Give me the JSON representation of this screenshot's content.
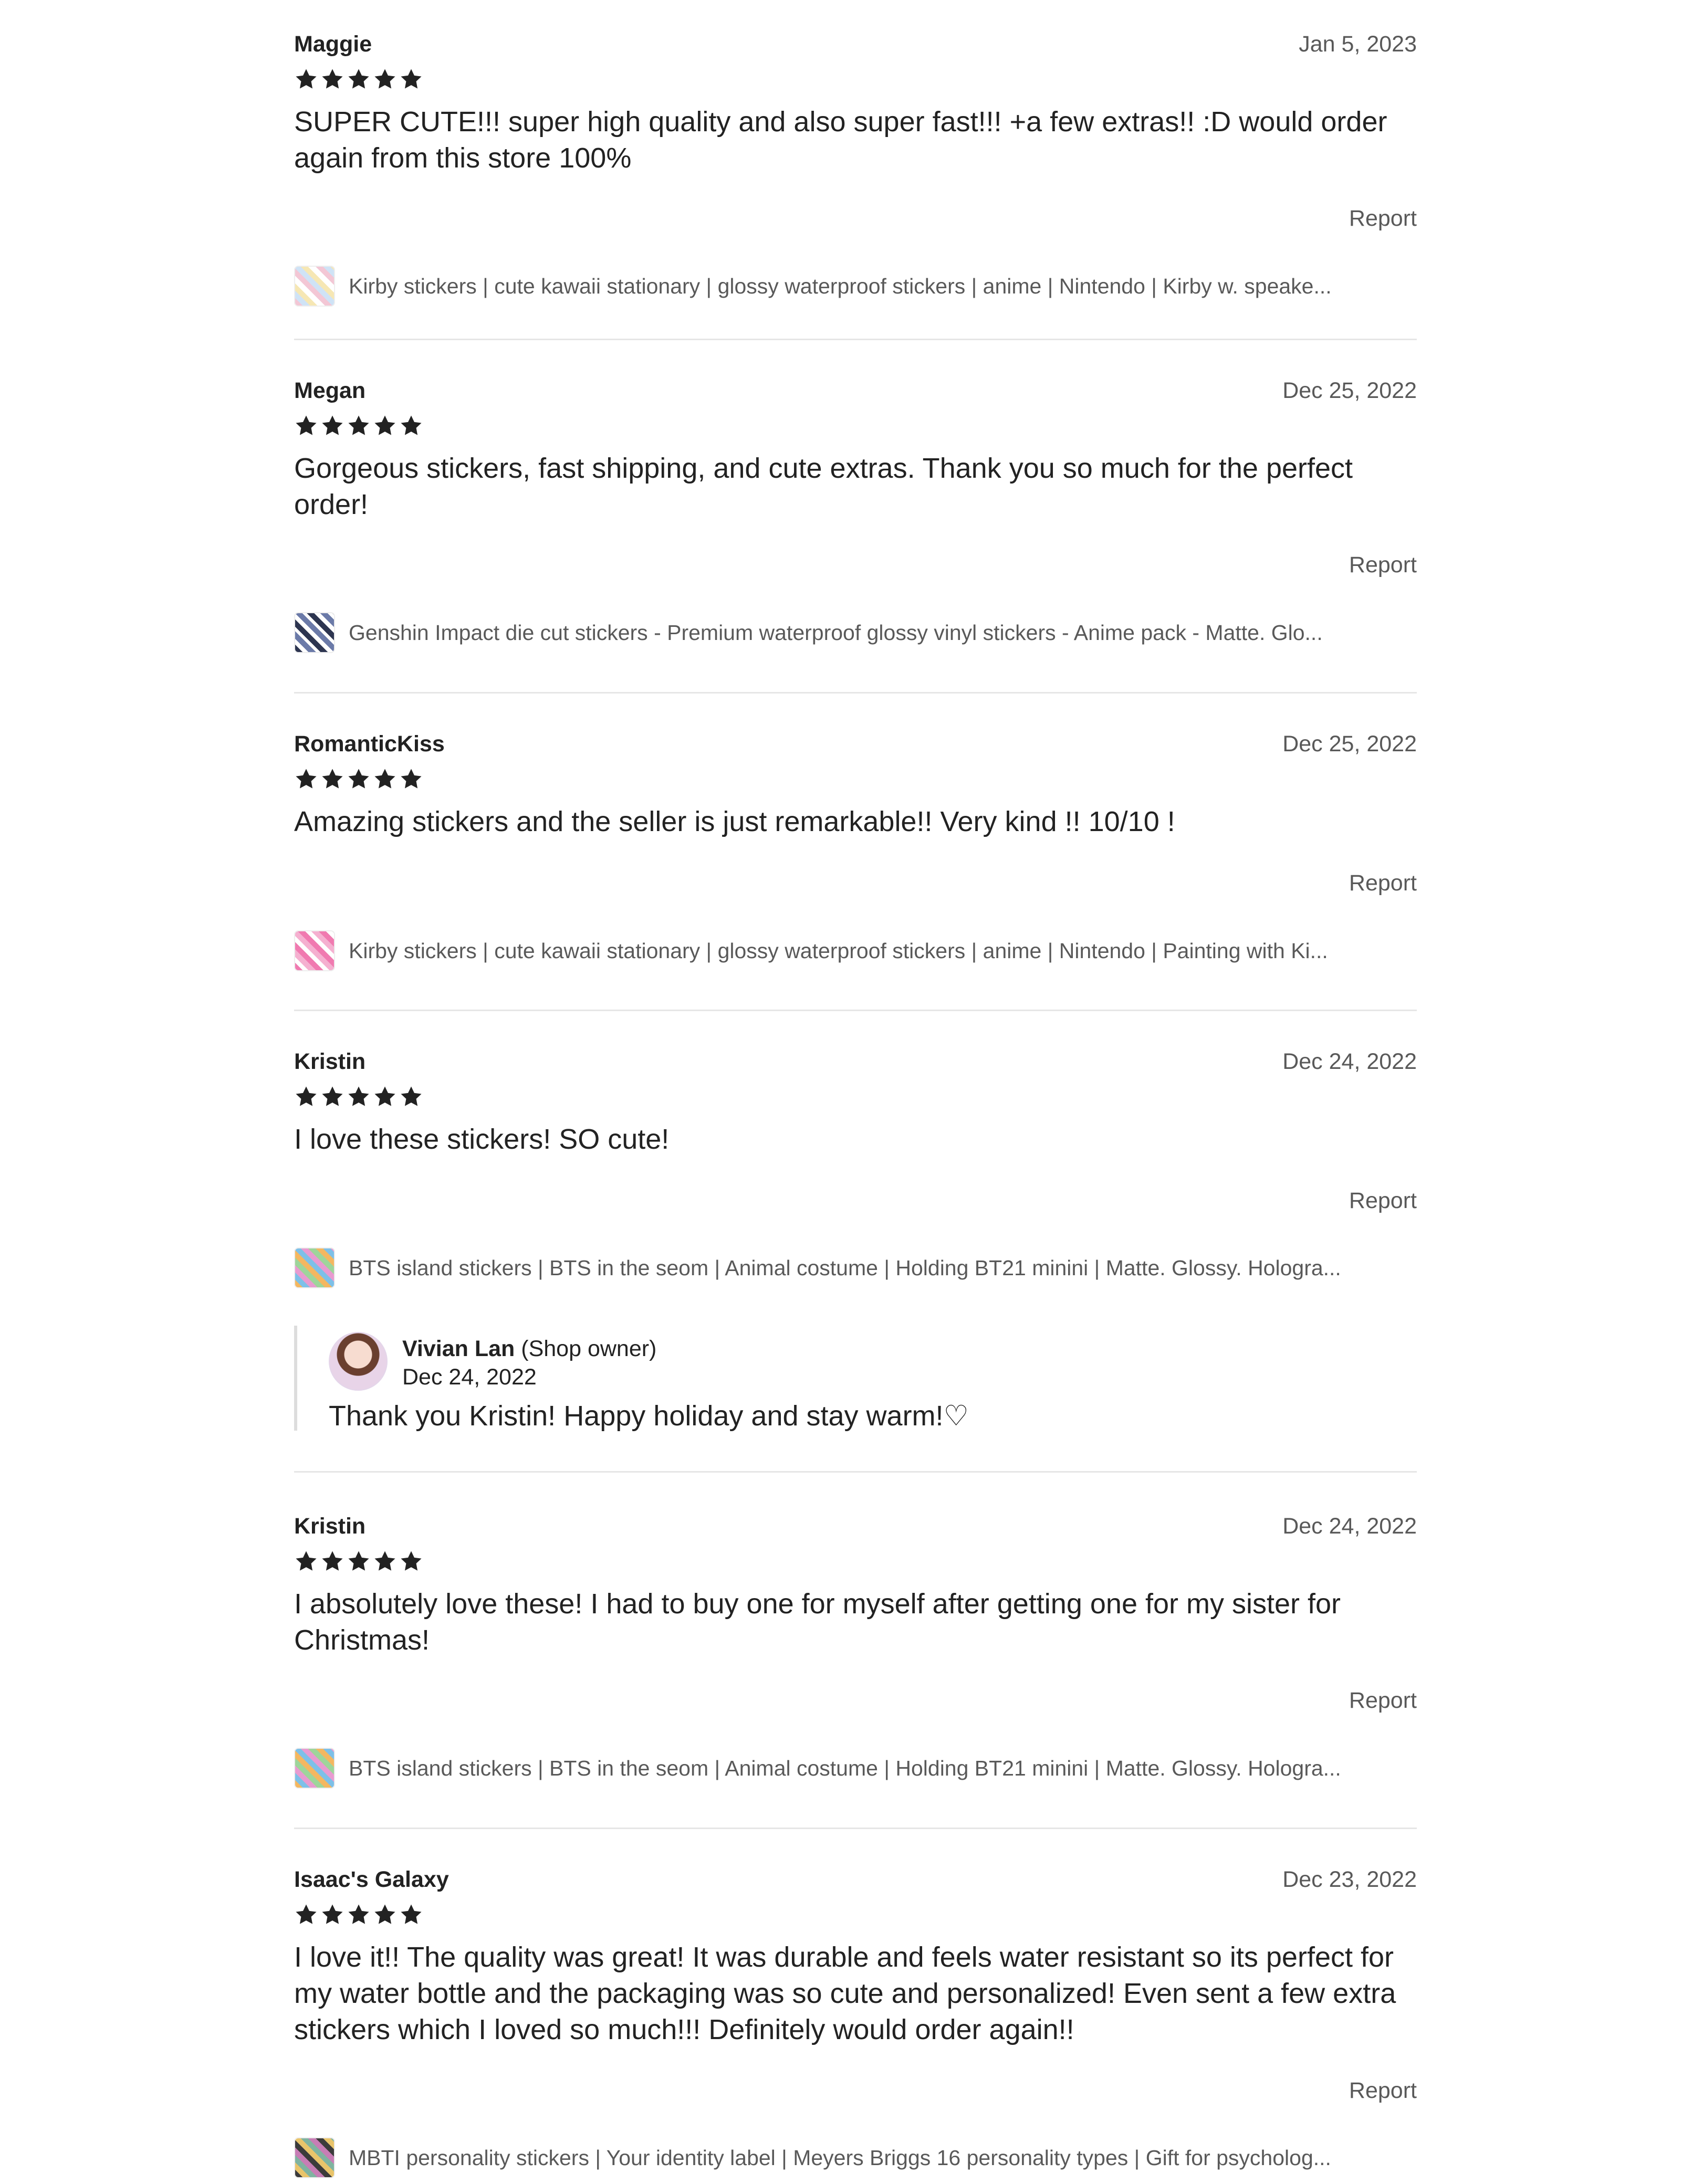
{
  "reviews": [
    {
      "reviewer": "Maggie",
      "date": "Jan 5, 2023",
      "rating": 5,
      "text": "SUPER CUTE!!! super high quality and also super fast!!! +a few extras!! :D would order again from this store 100%",
      "report_label": "Report",
      "product": "Kirby stickers | cute kawaii stationary | glossy waterproof stickers | anime | Nintendo | Kirby w. speake..."
    },
    {
      "reviewer": "Megan",
      "date": "Dec 25, 2022",
      "rating": 5,
      "text": "Gorgeous stickers, fast shipping, and cute extras. Thank you so much for the perfect order!",
      "report_label": "Report",
      "product": "Genshin Impact die cut stickers - Premium waterproof glossy vinyl stickers - Anime pack - Matte. Glo..."
    },
    {
      "reviewer": "RomanticKiss",
      "date": "Dec 25, 2022",
      "rating": 5,
      "text": "Amazing stickers and the seller is just remarkable!! Very kind !! 10/10 !",
      "report_label": "Report",
      "product": "Kirby stickers | cute kawaii stationary | glossy waterproof stickers | anime | Nintendo | Painting with Ki..."
    },
    {
      "reviewer": "Kristin",
      "date": "Dec 24, 2022",
      "rating": 5,
      "text": "I love these stickers! SO cute!",
      "report_label": "Report",
      "product": "BTS island stickers | BTS in the seom | Animal costume | Holding BT21 minini | Matte. Glossy. Hologra...",
      "reply": {
        "owner_name": "Vivian Lan",
        "owner_role": "(Shop owner)",
        "date": "Dec 24, 2022",
        "text": "Thank you Kristin! Happy holiday and stay warm!♡"
      }
    },
    {
      "reviewer": "Kristin",
      "date": "Dec 24, 2022",
      "rating": 5,
      "text": "I absolutely love these! I had to buy one for myself after getting one for my sister for Christmas!",
      "report_label": "Report",
      "product": "BTS island stickers | BTS in the seom | Animal costume | Holding BT21 minini | Matte. Glossy. Hologra..."
    },
    {
      "reviewer": "Isaac's Galaxy",
      "date": "Dec 23, 2022",
      "rating": 5,
      "text": "I love it!! The quality was great! It was durable and feels water resistant so its perfect for my water bottle and the packaging was so cute and personalized! Even sent a few extra stickers which I loved so much!!! Definitely would order again!!",
      "report_label": "Report",
      "product": "MBTI personality stickers | Your identity label | Meyers Briggs 16 personality types | Gift for psycholog..."
    }
  ]
}
